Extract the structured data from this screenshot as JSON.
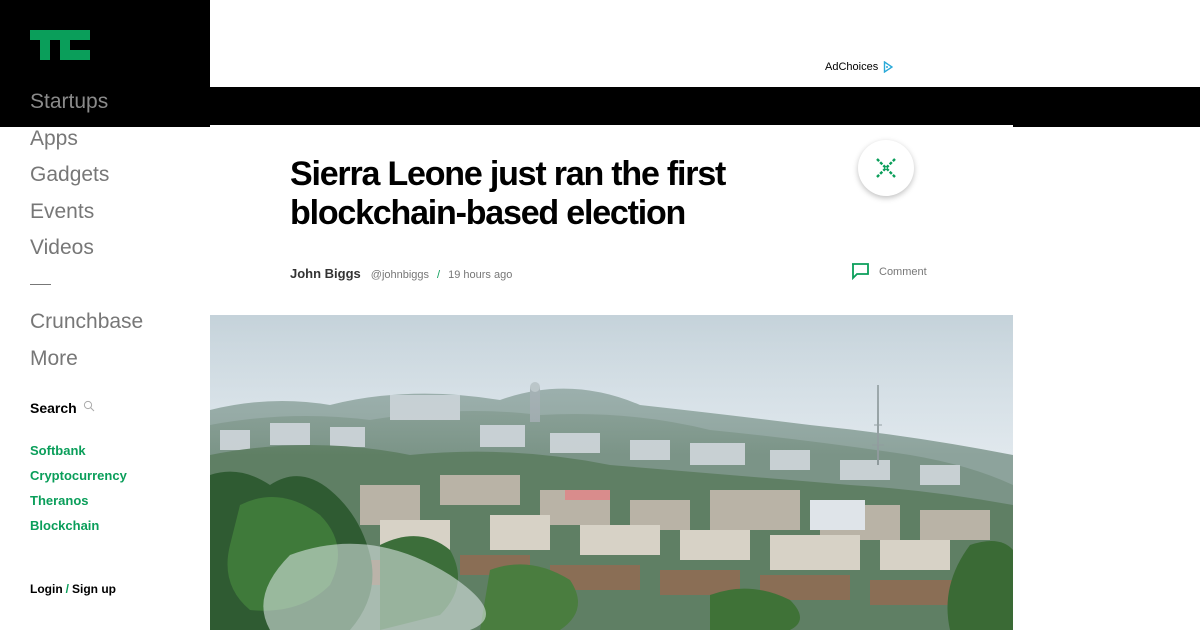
{
  "brand": {
    "logo_name": "TechCrunch logo",
    "accent": "#0a9e5a"
  },
  "nav": {
    "items": [
      {
        "label": "Startups"
      },
      {
        "label": "Apps"
      },
      {
        "label": "Gadgets"
      },
      {
        "label": "Events"
      },
      {
        "label": "Videos"
      }
    ],
    "items_secondary": [
      {
        "label": "Crunchbase"
      },
      {
        "label": "More"
      }
    ]
  },
  "search": {
    "label": "Search",
    "icon": "search-icon"
  },
  "tags": [
    {
      "label": "Softbank"
    },
    {
      "label": "Cryptocurrency"
    },
    {
      "label": "Theranos"
    },
    {
      "label": "Blockchain"
    }
  ],
  "auth": {
    "login": "Login",
    "separator": "/",
    "signup": "Sign up"
  },
  "ad": {
    "adchoices_label": "AdChoices"
  },
  "article": {
    "title": "Sierra Leone just ran the first blockchain-based election",
    "author": "John Biggs",
    "handle": "@johnbiggs",
    "separator": "/",
    "time": "19 hours ago",
    "comment_label": "Comment",
    "close_icon": "close-icon"
  }
}
